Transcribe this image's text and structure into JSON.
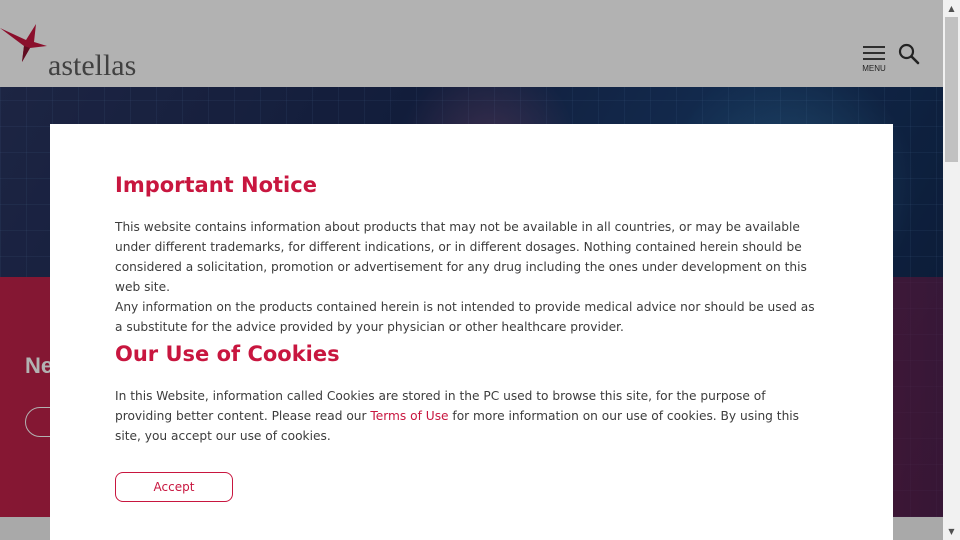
{
  "header": {
    "logo_text": "astellas",
    "menu_label": "MENU"
  },
  "hero": {
    "heading_partial": "Ne"
  },
  "modal": {
    "notice_title": "Important Notice",
    "notice_body_1": "This website contains information about products that may not be available in all countries, or may be available under different trademarks, for different indications, or in different dosages. Nothing contained herein should be considered a solicitation, promotion or advertisement for any drug including the ones under development on this web site.",
    "notice_body_2": "Any information on the products contained herein is not intended to provide medical advice nor should be used as a substitute for the advice provided by your physician or other healthcare provider.",
    "cookies_title": "Our Use of Cookies",
    "cookies_body_before": "In this Website, information called Cookies are stored in the PC used to browse this site, for the purpose of providing better content. Please read our ",
    "cookies_link": "Terms of Use",
    "cookies_body_after": " for more information on our use of cookies. By using this site, you accept our use of cookies.",
    "accept_label": "Accept"
  },
  "colors": {
    "accent": "#c8163f",
    "body_text": "#3c3c3c"
  }
}
